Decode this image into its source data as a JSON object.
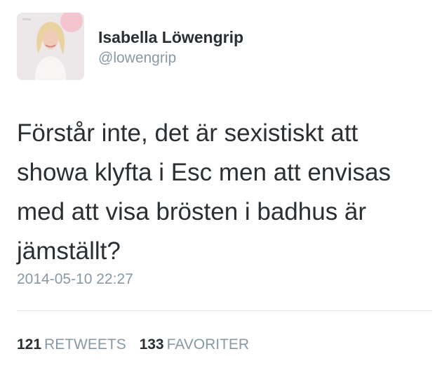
{
  "user": {
    "name": "Isabella Löwengrip",
    "handle": "@lowengrip"
  },
  "tweet": {
    "text": "Förstår inte, det är sexistiskt att showa klyfta i Esc men att envisas med att visa brösten i badhus är jämställt?",
    "timestamp": "2014-05-10 22:27"
  },
  "stats": {
    "retweets_count": "121",
    "retweets_label": "RETWEETS",
    "favorites_count": "133",
    "favorites_label": "FAVORITER"
  }
}
